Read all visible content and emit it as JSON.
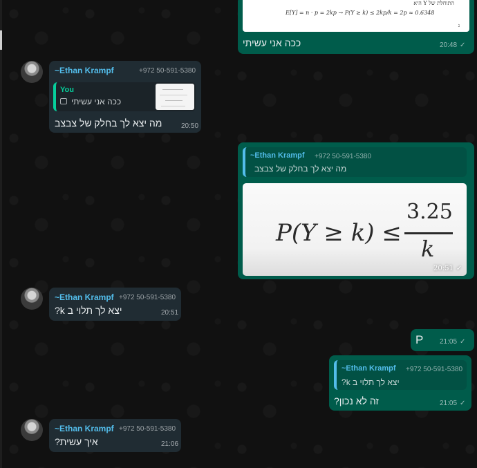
{
  "colors": {
    "incoming_bubble": "#202c33",
    "outgoing_bubble": "#005c4b",
    "sender_name": "#53bdeb",
    "quote_accent_you": "#06cf9c"
  },
  "messages": [
    {
      "id": "m1",
      "direction": "out",
      "image": {
        "top_text": "התוחלת של Y היא",
        "formula": "E[Y] = n · p = 2kp → P(Y ≥ k) ≤ 2kp/k = 2p ≈ 0.6348",
        "corner_mark": "נ"
      },
      "text": "ככה אני עשיתי",
      "time": "20:48"
    },
    {
      "id": "m2",
      "direction": "in",
      "sender": "~Ethan Krampf",
      "phone": "+972 50-591-5380",
      "quote": {
        "sender": "You",
        "text": "ככה אני עשיתי",
        "icon": "image-icon"
      },
      "text": "מה יצא לך בחלק של צבצב",
      "time": "20:50"
    },
    {
      "id": "m3",
      "direction": "out",
      "quote": {
        "sender": "~Ethan Krampf",
        "phone": "+972 50-591-5380",
        "text": "מה יצא לך בחלק של צבצב"
      },
      "image": {
        "formula_lhs": "P(Y ≥ k) ≤",
        "numerator": "3.25",
        "denominator": "k"
      },
      "time": "20:51"
    },
    {
      "id": "m4",
      "direction": "in",
      "sender": "~Ethan Krampf",
      "phone": "+972 50-591-5380",
      "text": "יצא לך תלוי ב k?",
      "time": "20:51"
    },
    {
      "id": "m5",
      "direction": "out",
      "text": "P",
      "time": "21:05"
    },
    {
      "id": "m6",
      "direction": "out",
      "quote": {
        "sender": "~Ethan Krampf",
        "phone": "+972 50-591-5380",
        "text": "יצא לך תלוי ב k?"
      },
      "text": "זה לא נכון?",
      "time": "21:05"
    },
    {
      "id": "m7",
      "direction": "in",
      "sender": "~Ethan Krampf",
      "phone": "+972 50-591-5380",
      "text": "איך עשית?",
      "time": "21:06"
    }
  ],
  "icons": {
    "read_tick": "✓"
  }
}
